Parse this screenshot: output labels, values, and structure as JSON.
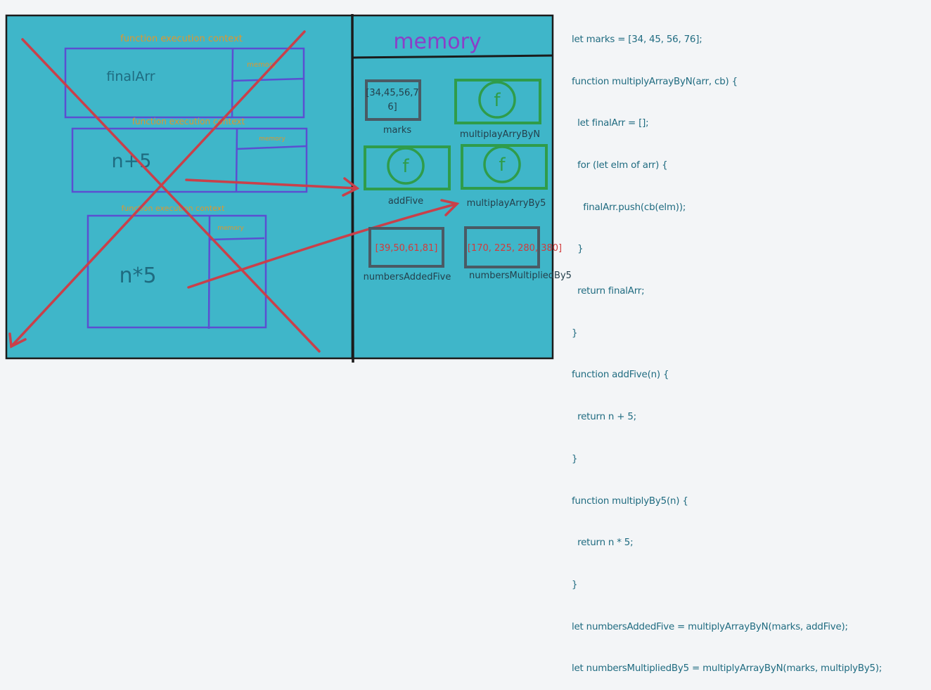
{
  "left_panel": {
    "context_1_title": "function execution context",
    "context_1_memory": "memory",
    "context_1_value": "finalArr",
    "context_2_title": "function execution context",
    "context_2_memory": "memory",
    "context_2_value": "n+5",
    "context_3_title": "function execution context",
    "context_3_memory": "memory",
    "context_3_value": "n*5"
  },
  "memory_panel": {
    "title": "memory",
    "marks_value_line1": "[34,45,56,7",
    "marks_value_line2": "6]",
    "marks_label": "marks",
    "multiply_array_label": "multiplayArryByN",
    "add_five_label": "addFive",
    "multiply_by5_label": "multiplayArryBy5",
    "function_glyph": "f",
    "added_five_value": "[39,50,61,81]",
    "added_five_label": "numbersAddedFive",
    "multiplied_value": "[170, 225, 280, 380]",
    "multiplied_label": "numbersMultipliedBy5"
  },
  "code": {
    "lines": [
      "let marks = [34, 45, 56, 76];",
      "function multiplyArrayByN(arr, cb) {",
      "  let finalArr = [];",
      "  for (let elm of arr) {",
      "    finalArr.push(cb(elm));",
      "  }",
      "  return finalArr;",
      "}",
      "function addFive(n) {",
      "  return n + 5;",
      "}",
      "function multiplyBy5(n) {",
      "  return n * 5;",
      "}",
      "let numbersAddedFive = multiplyArrayByN(marks, addFive);",
      "let numbersMultipliedBy5 = multiplyArrayByN(marks, multiplyBy5);"
    ]
  },
  "colors": {
    "panel_bg": "#3fb6c9",
    "context_box": "#5b4fd1",
    "cross": "#c9404a",
    "heading_orange": "#e0962c",
    "memory_title": "#8b3fc8",
    "value_box": "#4a5a64",
    "function_green": "#2f9c4a",
    "text_teal": "#1f6b80",
    "text_dark": "#24404c",
    "result_red": "#d23b3b"
  }
}
